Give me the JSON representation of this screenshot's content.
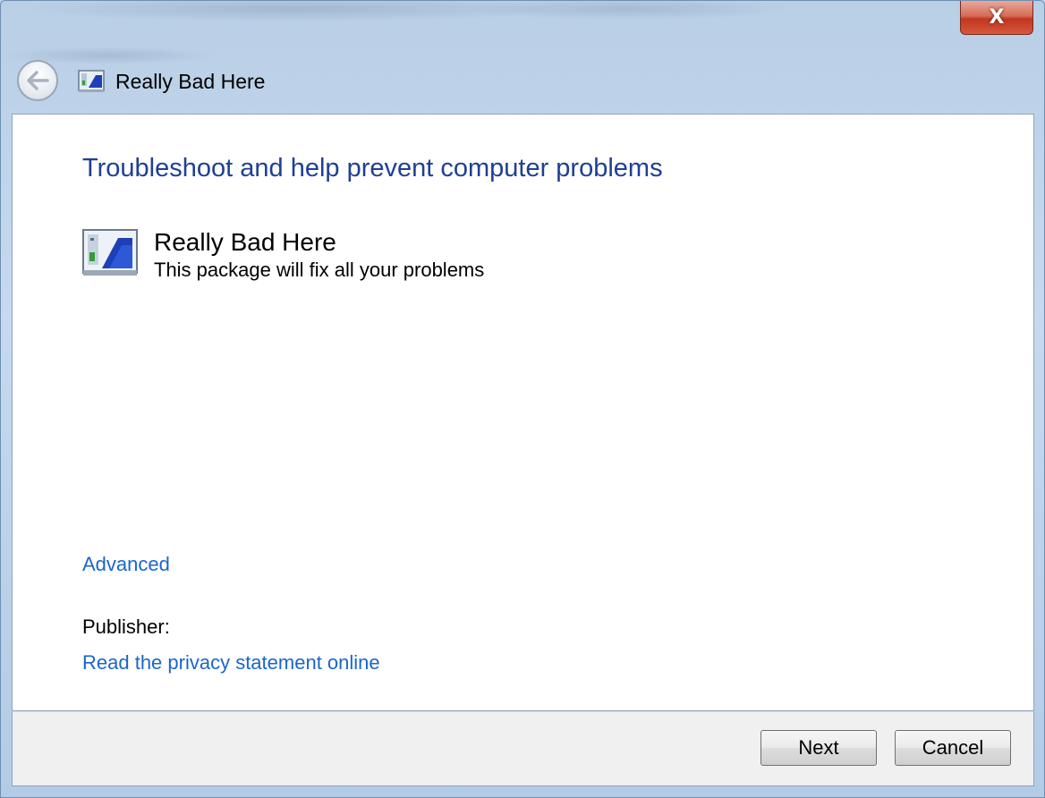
{
  "window": {
    "title": "Really Bad Here",
    "close_label": "X"
  },
  "main": {
    "heading": "Troubleshoot and help prevent computer problems",
    "package_name": "Really Bad Here",
    "package_description": "This package will fix all your problems",
    "advanced_link": "Advanced",
    "publisher_label": "Publisher:",
    "privacy_link": "Read the privacy statement online"
  },
  "footer": {
    "next_label": "Next",
    "cancel_label": "Cancel"
  },
  "icons": {
    "back": "back-arrow-icon",
    "app": "troubleshooter-monitor-icon",
    "close": "close-icon"
  },
  "colors": {
    "heading": "#1f3f96",
    "link": "#1a66cc",
    "close_button": "#c2351e",
    "frame": "#b9cfe6"
  }
}
